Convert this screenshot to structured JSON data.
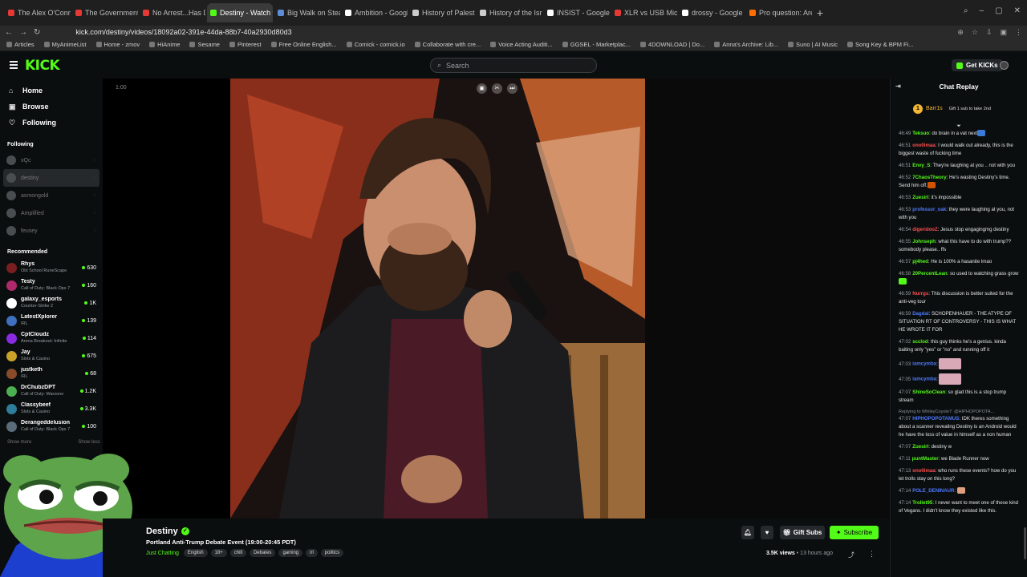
{
  "browser": {
    "tabs": [
      {
        "label": "The Alex O'Connor Podcast",
        "color": "#e53935",
        "active": false
      },
      {
        "label": "The Government Shutdown",
        "color": "#e53935",
        "active": false
      },
      {
        "label": "No Arrest...Has Dilvd Ben",
        "color": "#e53935",
        "active": false
      },
      {
        "label": "Destiny - Watch the Vi",
        "color": "#53fc18",
        "active": true
      },
      {
        "label": "Big Walk on Steam",
        "color": "#5b8dd9",
        "active": false
      },
      {
        "label": "Ambition - Google Search",
        "color": "#ffffff",
        "active": false
      },
      {
        "label": "History of Palestine - Wiki",
        "color": "#cccccc",
        "active": false
      },
      {
        "label": "History of the Israeli–Pale",
        "color": "#cccccc",
        "active": false
      },
      {
        "label": "INSIST - Google Search",
        "color": "#ffffff",
        "active": false
      },
      {
        "label": "XLR vs USB Mic: Which Sh",
        "color": "#e53935",
        "active": false
      },
      {
        "label": "drossy - Google Search",
        "color": "#ffffff",
        "active": false
      },
      {
        "label": "Pro question: Are all mics",
        "color": "#ff6d00",
        "active": false
      }
    ],
    "url": "kick.com/destiny/videos/18092a02-391e-44da-88b7-40a2930d80d3",
    "bookmarks": [
      "Articles",
      "MyAnimeList",
      "Home - zmov",
      "HiAnime",
      "Sesame",
      "Pinterest",
      "Free Online English...",
      "Comick - comick.io",
      "Collaborate with cre...",
      "Voice Acting Auditi...",
      "GGSEL - Marketplac...",
      "4DOWNLOAD | Do...",
      "Anna's Archive: Lib...",
      "Suno | AI Music",
      "Song Key & BPM Fi..."
    ]
  },
  "header": {
    "logo": "KICK",
    "search_placeholder": "Search",
    "get_kicks": "Get KICKs"
  },
  "sidebar": {
    "nav": [
      {
        "label": "Home",
        "icon": "home-icon"
      },
      {
        "label": "Browse",
        "icon": "browse-icon"
      },
      {
        "label": "Following",
        "icon": "heart-icon"
      }
    ],
    "following_title": "Following",
    "following": [
      "xQc",
      "destiny",
      "asmongold",
      "Amplified",
      "feusey"
    ],
    "recommended_title": "Recommended",
    "recommended": [
      {
        "name": "Rhys",
        "category": "Old School RuneScape",
        "viewers": "630",
        "color": "#7a1f1f"
      },
      {
        "name": "Testy",
        "category": "Call of Duty: Black Ops 7",
        "viewers": "160",
        "color": "#b02a6b"
      },
      {
        "name": "galaxy_esports",
        "category": "Counter-Strike 2",
        "viewers": "1K",
        "color": "#ffffff"
      },
      {
        "name": "LatestXplorer",
        "category": "IRL",
        "viewers": "139",
        "color": "#3f6fbf"
      },
      {
        "name": "CptCloudz",
        "category": "Arena Breakout: Infinite",
        "viewers": "114",
        "color": "#8a2be2"
      },
      {
        "name": "Jay",
        "category": "Slots & Casino",
        "viewers": "675",
        "color": "#c9a227"
      },
      {
        "name": "justketh",
        "category": "IRL",
        "viewers": "68",
        "color": "#8a4b2a"
      },
      {
        "name": "DrChubzDPT",
        "category": "Call of Duty: Warzone",
        "viewers": "1.2K",
        "color": "#4caf50"
      },
      {
        "name": "Classybeef",
        "category": "Slots & Casino",
        "viewers": "3.3K",
        "color": "#2e7d9a"
      },
      {
        "name": "Derangeddelusion",
        "category": "Call of Duty: Black Ops 7",
        "viewers": "100",
        "color": "#5a6b7a"
      }
    ],
    "show_more": "Show more",
    "show_less": "Show less"
  },
  "video": {
    "time": "1:00"
  },
  "channel": {
    "name": "Destiny",
    "title": "Portland Anti-Trump Debate Event (19:00-20:45 PDT)",
    "category": "Just Chatting",
    "tags": [
      "English",
      "18+",
      "chill",
      "Debates",
      "gaming",
      "irl",
      "politics"
    ],
    "gift_subs": "Gift Subs",
    "subscribe": "Subscribe",
    "views": "3.5K views",
    "ago": "13 hours ago"
  },
  "chat": {
    "title": "Chat Replay",
    "pinned_user": "Barr1s",
    "pinned_rank": "1",
    "pinned_text": "Gift 1 sub to take 2nd",
    "messages": [
      {
        "time": "46:49",
        "user": "Teksuo",
        "color": "#53fc18",
        "text": "do brain in a vat next",
        "emote": "#3a7bd5"
      },
      {
        "time": "46:51",
        "user": "ono0imaa",
        "color": "#ff4d4d",
        "text": "I would walk out already, this is the biggest waste of fucking time"
      },
      {
        "time": "46:51",
        "user": "Envy_S",
        "color": "#53fc18",
        "text": "They're laughing at you .. not with you"
      },
      {
        "time": "46:52",
        "user": "7ChaosTheory",
        "color": "#53fc18",
        "text": "He's wasting Destiny's time. Send him off.",
        "emote": "#d35400"
      },
      {
        "time": "46:53",
        "user": "Zuesirl",
        "color": "#53fc18",
        "text": "it's impossible"
      },
      {
        "time": "46:53",
        "user": "professor_oak",
        "color": "#4d79ff",
        "text": "they were laughing at you, not with you"
      },
      {
        "time": "46:54",
        "user": "digeridooZ",
        "color": "#ff4d4d",
        "text": "Jesus stop engagingmg destiny"
      },
      {
        "time": "46:55",
        "user": "Johnseph",
        "color": "#53fc18",
        "text": "what this have to do with trump?? somebody please.. ffs"
      },
      {
        "time": "46:57",
        "user": "pj4hed",
        "color": "#53fc18",
        "text": "He is 100% a hasanite lmao"
      },
      {
        "time": "46:58",
        "user": "20PercentLean",
        "color": "#53fc18",
        "text": "so used to watching grass grow",
        "emote": "#53fc18"
      },
      {
        "time": "46:59",
        "user": "Nurrgs",
        "color": "#ff4d4d",
        "text": "This discussion is better suited for the anti-veg tour"
      },
      {
        "time": "46:59",
        "user": "Dagdal",
        "color": "#4d79ff",
        "text": "SCHOPENHAUER - THE ATYPE OF SITUATION RT OF CONTROVERSY - THIS IS WHAT HE WROTE IT FOR"
      },
      {
        "time": "47:02",
        "user": "scclod",
        "color": "#53fc18",
        "text": "this guy thinks he's a genius. kinda baiting only \"yes\" or \"no\" and running off it"
      },
      {
        "time": "47:03",
        "user": "iamcymba",
        "color": "#4d79ff",
        "text": "",
        "big": true
      },
      {
        "time": "47:05",
        "user": "iamcymba",
        "color": "#4d79ff",
        "text": "",
        "big": true
      },
      {
        "time": "47:07",
        "user": "ShineSoClean",
        "color": "#53fc18",
        "text": "so glad this is a stop trump stream"
      },
      {
        "time": "47:07",
        "user": "HIPHOPOPOTAMUS",
        "color": "#4d79ff",
        "text": "IDK theres something about a scanner revealing Destiny is an Android would he have the loss of value in himself as a non human",
        "reply": "Replying to WhileyCoyote7: @HIPHOPOPOTA..."
      },
      {
        "time": "47:07",
        "user": "Zuesirl",
        "color": "#53fc18",
        "text": "destiny w"
      },
      {
        "time": "47:11",
        "user": "puntMaster",
        "color": "#53fc18",
        "text": "we Blade Runner now"
      },
      {
        "time": "47:13",
        "user": "ono0imaa",
        "color": "#ff4d4d",
        "text": "who runs these events? how do you let trolls stay on this long?"
      },
      {
        "time": "47:14",
        "user": "POLE_DENINAUR",
        "color": "#4d79ff",
        "text": "",
        "emote": "#e0a080"
      },
      {
        "time": "47:14",
        "user": "Trollet95",
        "color": "#53fc18",
        "text": "I never want to meet one of these kind of Vegans. I didn't know they existed like this."
      }
    ]
  }
}
